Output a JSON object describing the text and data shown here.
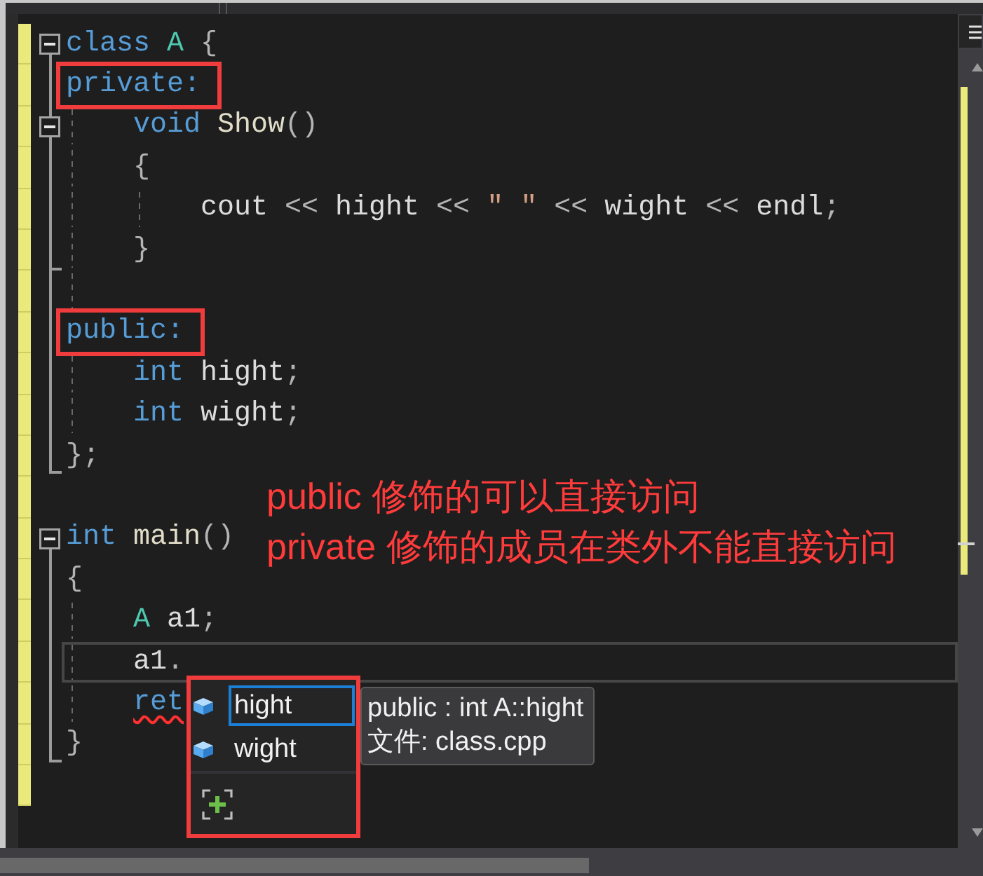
{
  "editor": {
    "lines": [
      {
        "tokens": [
          {
            "text": "class ",
            "kind": "keyword"
          },
          {
            "text": "A ",
            "kind": "type"
          },
          {
            "text": "{",
            "kind": "punct"
          }
        ],
        "kind": "fold-start",
        "expanded": true,
        "modified": true,
        "current": false,
        "outlined": false
      },
      {
        "tokens": [
          {
            "text": "private:",
            "kind": "keyword"
          }
        ],
        "kind": "line",
        "modified": true,
        "current": false,
        "outlined": true,
        "children": [
          {
            "tokens": [
              {
                "text": "void ",
                "kind": "keyword"
              },
              {
                "text": "Show",
                "kind": "function"
              },
              {
                "text": "()",
                "kind": "punct"
              }
            ],
            "kind": "fold-inner",
            "expanded": true,
            "modified": true,
            "current": false,
            "outlined": false
          },
          {
            "tokens": [
              {
                "text": "{",
                "kind": "punct"
              }
            ],
            "kind": "line",
            "modified": true,
            "current": false,
            "outlined": false,
            "children": [
              {
                "tokens": [
                  {
                    "text": "cout ",
                    "kind": "ident"
                  },
                  {
                    "text": "<< ",
                    "kind": "op"
                  },
                  {
                    "text": "hight ",
                    "kind": "ident"
                  },
                  {
                    "text": "<< ",
                    "kind": "op"
                  },
                  {
                    "text": "\" \" ",
                    "kind": "string"
                  },
                  {
                    "text": "<< ",
                    "kind": "op"
                  },
                  {
                    "text": "wight ",
                    "kind": "ident"
                  },
                  {
                    "text": "<< ",
                    "kind": "op"
                  },
                  {
                    "text": "endl",
                    "kind": "ident"
                  },
                  {
                    "text": ";",
                    "kind": "punct"
                  }
                ],
                "kind": "line",
                "modified": true,
                "current": false,
                "outlined": false
              }
            ]
          },
          {
            "tokens": [
              {
                "text": "}",
                "kind": "punct"
              }
            ],
            "kind": "branch",
            "modified": true,
            "current": false,
            "outlined": false
          },
          {
            "kind": "line",
            "modified": true,
            "current": false,
            "outlined": false
          }
        ]
      },
      {
        "tokens": [
          {
            "text": "public:",
            "kind": "keyword"
          }
        ],
        "kind": "line",
        "modified": true,
        "current": false,
        "outlined": true,
        "children": [
          {
            "tokens": [
              {
                "text": "int ",
                "kind": "keyword"
              },
              {
                "text": "hight",
                "kind": "ident"
              },
              {
                "text": ";",
                "kind": "punct"
              }
            ],
            "kind": "line",
            "modified": true,
            "current": false,
            "outlined": false
          },
          {
            "tokens": [
              {
                "text": "int ",
                "kind": "keyword"
              },
              {
                "text": "wight",
                "kind": "ident"
              },
              {
                "text": ";",
                "kind": "punct"
              }
            ],
            "kind": "line",
            "modified": true,
            "current": false,
            "outlined": false
          }
        ]
      },
      {
        "tokens": [
          {
            "text": "};",
            "kind": "punct"
          }
        ],
        "kind": "end",
        "modified": true,
        "current": false,
        "outlined": false
      },
      {
        "kind": "none",
        "modified": true,
        "current": false,
        "outlined": false
      },
      {
        "tokens": [
          {
            "text": "int ",
            "kind": "keyword"
          },
          {
            "text": "main",
            "kind": "function"
          },
          {
            "text": "()",
            "kind": "punct"
          }
        ],
        "kind": "fold-start",
        "expanded": true,
        "modified": true,
        "current": false,
        "outlined": false
      },
      {
        "tokens": [
          {
            "text": "{",
            "kind": "punct"
          }
        ],
        "kind": "line",
        "modified": true,
        "current": false,
        "outlined": false,
        "children": [
          {
            "tokens": [
              {
                "text": "A ",
                "kind": "type"
              },
              {
                "text": "a1",
                "kind": "ident"
              },
              {
                "text": ";",
                "kind": "punct"
              }
            ],
            "kind": "line",
            "modified": true,
            "current": false,
            "outlined": false
          },
          {
            "tokens": [
              {
                "text": "a1",
                "kind": "ident"
              },
              {
                "text": ".",
                "kind": "punct"
              }
            ],
            "kind": "line",
            "modified": true,
            "current": true,
            "outlined": false
          },
          {
            "tokens": [
              {
                "text": "ret",
                "kind": "error"
              }
            ],
            "kind": "line",
            "modified": true,
            "current": false,
            "outlined": false
          }
        ]
      },
      {
        "tokens": [
          {
            "text": "}",
            "kind": "punct"
          }
        ],
        "kind": "end",
        "modified": true,
        "current": false,
        "outlined": false
      },
      {
        "kind": "none",
        "modified": true,
        "current": false,
        "outlined": false
      }
    ]
  },
  "completion_popup": {
    "outlined": true,
    "items": [
      {
        "label": "hight",
        "selected": true
      },
      {
        "label": "wight",
        "selected": false
      }
    ],
    "tooltip": {
      "signature": "public : int A::hight",
      "file": "文件: class.cpp"
    }
  },
  "annotation": {
    "lines": [
      "public 修饰的可以直接访问",
      "private 修饰的成员在类外不能直接访问"
    ]
  }
}
